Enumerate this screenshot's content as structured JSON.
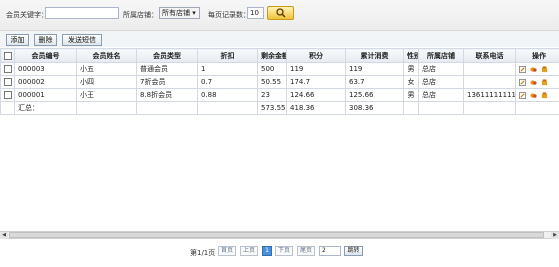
{
  "toolbar": {
    "keyword_label": "会员关键字：",
    "keyword_value": "",
    "store_label": "所属店铺：",
    "store_value": "所有店铺 ▾",
    "pagesize_label": "每页记录数：",
    "pagesize_value": "10"
  },
  "actions": {
    "add": "添加",
    "delete": "删除",
    "send_sms": "发送短信"
  },
  "table": {
    "headers": [
      "会员编号",
      "会员姓名",
      "会员类型",
      "折扣",
      "剩余金额",
      "积分",
      "累计消费",
      "性别",
      "所属店铺",
      "联系电话",
      "操作"
    ],
    "rows": [
      {
        "id": "000003",
        "name": "小五",
        "type": "普通会员",
        "discount": "1",
        "balance": "500",
        "points": "119",
        "total": "119",
        "gender": "男",
        "store": "总店",
        "phone": ""
      },
      {
        "id": "000002",
        "name": "小四",
        "type": "7折会员",
        "discount": "0.7",
        "balance": "50.55",
        "points": "174.7",
        "total": "63.7",
        "gender": "女",
        "store": "总店",
        "phone": ""
      },
      {
        "id": "000001",
        "name": "小王",
        "type": "8.8折会员",
        "discount": "0.88",
        "balance": "23",
        "points": "124.66",
        "total": "125.66",
        "gender": "男",
        "store": "总店",
        "phone": "13611111111"
      }
    ],
    "summary": {
      "label": "汇总：",
      "balance": "573.55",
      "points": "418.36",
      "total": "308.36"
    }
  },
  "pager": {
    "info": "第1/1页",
    "first": "首页",
    "prev": "上页",
    "current": "1",
    "next": "下页",
    "last": "尾页",
    "jump_value": "2",
    "goto": "跳转"
  },
  "colors": {
    "accent": "#4a90d9",
    "search": "#f0c43b"
  }
}
